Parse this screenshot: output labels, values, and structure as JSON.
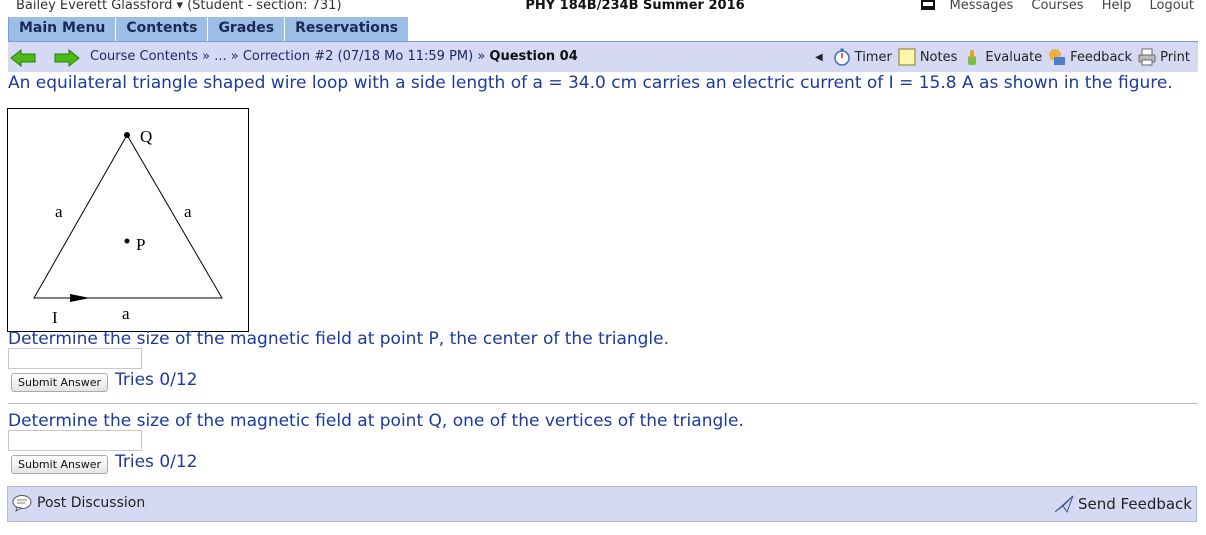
{
  "header": {
    "user": "Bailey Everett Glassford ▾ (Student  - section: 731)",
    "course": "PHY 184B/234B Summer 2016",
    "links": [
      "Messages",
      "Courses",
      "Help",
      "Logout"
    ]
  },
  "menu": [
    "Main Menu",
    "Contents",
    "Grades",
    "Reservations"
  ],
  "nav": {
    "crumb_text": "Course Contents » ... » Correction #2 (07/18 Mo 11:59 PM) » ",
    "crumb_bold": "Question 04",
    "tools": [
      "Timer",
      "Notes",
      "Evaluate",
      "Feedback",
      "Print"
    ]
  },
  "question": {
    "intro": "An equilateral triangle shaped wire loop with a side length of a = 34.0 cm carries an electric current of I = 15.8 A as shown in the figure.",
    "figure_labels": {
      "Q": "Q",
      "P": "P",
      "a": "a",
      "I": "I"
    },
    "part1": "Determine the size of the magnetic field at point P, the center of the triangle.",
    "part2": "Determine the size of the magnetic field at point Q, one of the vertices of the triangle.",
    "submit_label": "Submit Answer",
    "tries1": "Tries 0/12",
    "tries2": "Tries 0/12"
  },
  "footer": {
    "post": "Post Discussion",
    "send": "Send Feedback"
  },
  "colors": {
    "menu": "#9bbde6",
    "navbar": "#d5d9f3",
    "question_text": "#1a3aa0"
  }
}
